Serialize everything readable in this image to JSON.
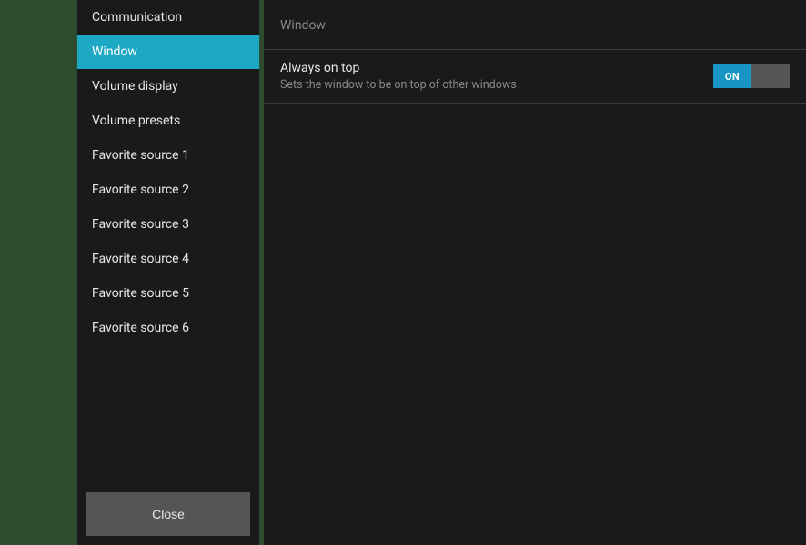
{
  "sidebar": {
    "items": [
      {
        "label": "Communication",
        "selected": false
      },
      {
        "label": "Window",
        "selected": true
      },
      {
        "label": "Volume display",
        "selected": false
      },
      {
        "label": "Volume presets",
        "selected": false
      },
      {
        "label": "Favorite source 1",
        "selected": false
      },
      {
        "label": "Favorite source 2",
        "selected": false
      },
      {
        "label": "Favorite source 3",
        "selected": false
      },
      {
        "label": "Favorite source 4",
        "selected": false
      },
      {
        "label": "Favorite source 5",
        "selected": false
      },
      {
        "label": "Favorite source 6",
        "selected": false
      }
    ],
    "close_label": "Close"
  },
  "main": {
    "header": "Window",
    "setting": {
      "title": "Always on top",
      "desc": "Sets the window to be on top of other windows",
      "toggle_state": "ON"
    }
  }
}
